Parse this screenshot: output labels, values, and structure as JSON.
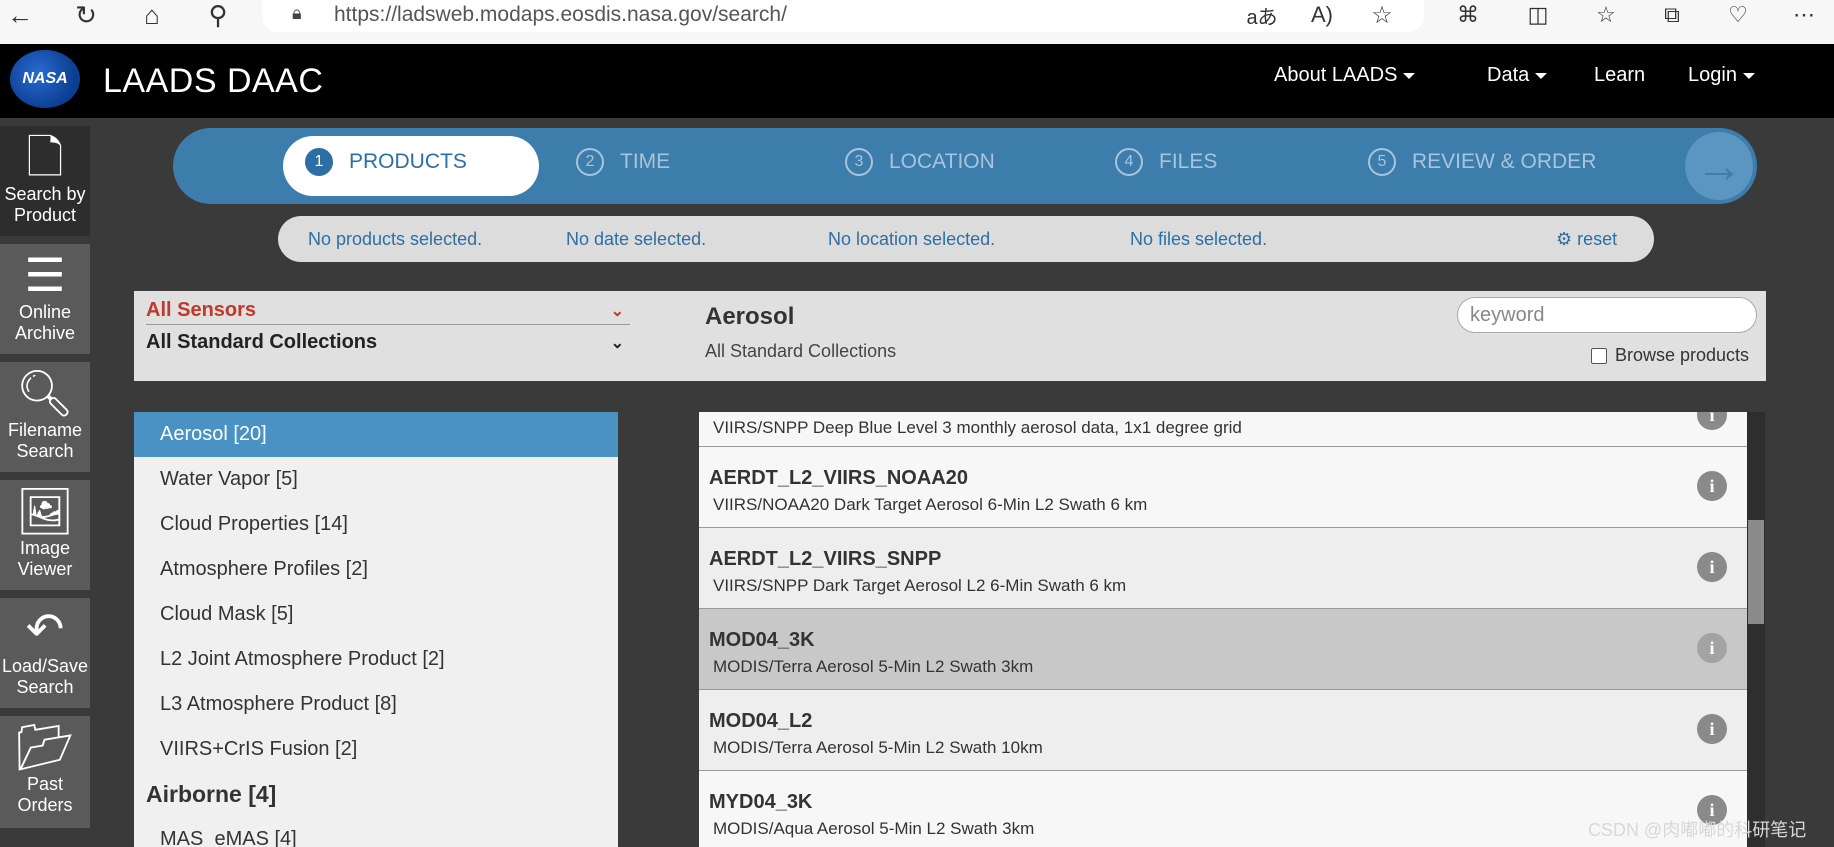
{
  "browser": {
    "url": "https://ladsweb.modaps.eosdis.nasa.gov/search/",
    "icons": [
      "back-icon",
      "refresh-icon",
      "home-icon",
      "search-icon",
      "lock-icon",
      "translate-icon",
      "read-aloud-icon",
      "favorite-star-icon",
      "extensions-icon",
      "split-screen-icon",
      "favorites-icon",
      "collections-icon",
      "browser-essentials-icon",
      "more-icon"
    ]
  },
  "nav": {
    "logo": "NASA",
    "title": "LAADS DAAC",
    "links": [
      "About LAADS",
      "Data",
      "Learn",
      "Login"
    ]
  },
  "sidebar": {
    "items": [
      {
        "label": "Search by Product",
        "icon": "document-icon",
        "active": true
      },
      {
        "label": "Online Archive",
        "icon": "numbered-list-icon"
      },
      {
        "label": "Filename Search",
        "icon": "magnifier-icon"
      },
      {
        "label": "Image Viewer",
        "icon": "image-icon"
      },
      {
        "label": "Load/Save Search",
        "icon": "reply-icon"
      },
      {
        "label": "Past Orders",
        "icon": "folder-open-icon"
      }
    ]
  },
  "steps": [
    {
      "num": "1",
      "label": "PRODUCTS"
    },
    {
      "num": "2",
      "label": "TIME"
    },
    {
      "num": "3",
      "label": "LOCATION"
    },
    {
      "num": "4",
      "label": "FILES"
    },
    {
      "num": "5",
      "label": "REVIEW & ORDER"
    }
  ],
  "status": {
    "products": "No products selected.",
    "date": "No date selected.",
    "location": "No location selected.",
    "files": "No files selected.",
    "reset": "reset"
  },
  "filters": {
    "sensor": "All Sensors",
    "collection": "All Standard Collections",
    "category_title": "Aerosol",
    "category_sub": "All Standard Collections",
    "keyword_placeholder": "keyword",
    "browse_label": "Browse products",
    "browse_checked": false
  },
  "categories": [
    {
      "label": "Aerosol [20]",
      "type": "item",
      "selected": true
    },
    {
      "label": "Water Vapor [5]",
      "type": "item"
    },
    {
      "label": "Cloud Properties [14]",
      "type": "item"
    },
    {
      "label": "Atmosphere Profiles [2]",
      "type": "item"
    },
    {
      "label": "Cloud Mask [5]",
      "type": "item"
    },
    {
      "label": "L2 Joint Atmosphere Product [2]",
      "type": "item"
    },
    {
      "label": "L3 Atmosphere Product [8]",
      "type": "item"
    },
    {
      "label": "VIIRS+CrIS Fusion [2]",
      "type": "item"
    },
    {
      "label": "Airborne [4]",
      "type": "group"
    },
    {
      "label": "MAS_eMAS [4]",
      "type": "item"
    }
  ],
  "products": [
    {
      "name": "",
      "desc": "VIIRS/SNPP Deep Blue Level 3 monthly aerosol data, 1x1 degree grid"
    },
    {
      "name": "AERDT_L2_VIIRS_NOAA20",
      "desc": "VIIRS/NOAA20 Dark Target Aerosol 6-Min L2 Swath 6 km"
    },
    {
      "name": "AERDT_L2_VIIRS_SNPP",
      "desc": "VIIRS/SNPP Dark Target Aerosol L2 6-Min Swath 6 km"
    },
    {
      "name": "MOD04_3K",
      "desc": "MODIS/Terra Aerosol 5-Min L2 Swath 3km",
      "highlighted": true
    },
    {
      "name": "MOD04_L2",
      "desc": "MODIS/Terra Aerosol 5-Min L2 Swath 10km"
    },
    {
      "name": "MYD04_3K",
      "desc": "MODIS/Aqua Aerosol 5-Min L2 Swath 3km"
    }
  ],
  "watermark": "CSDN @肉嘟嘟的科研笔记"
}
